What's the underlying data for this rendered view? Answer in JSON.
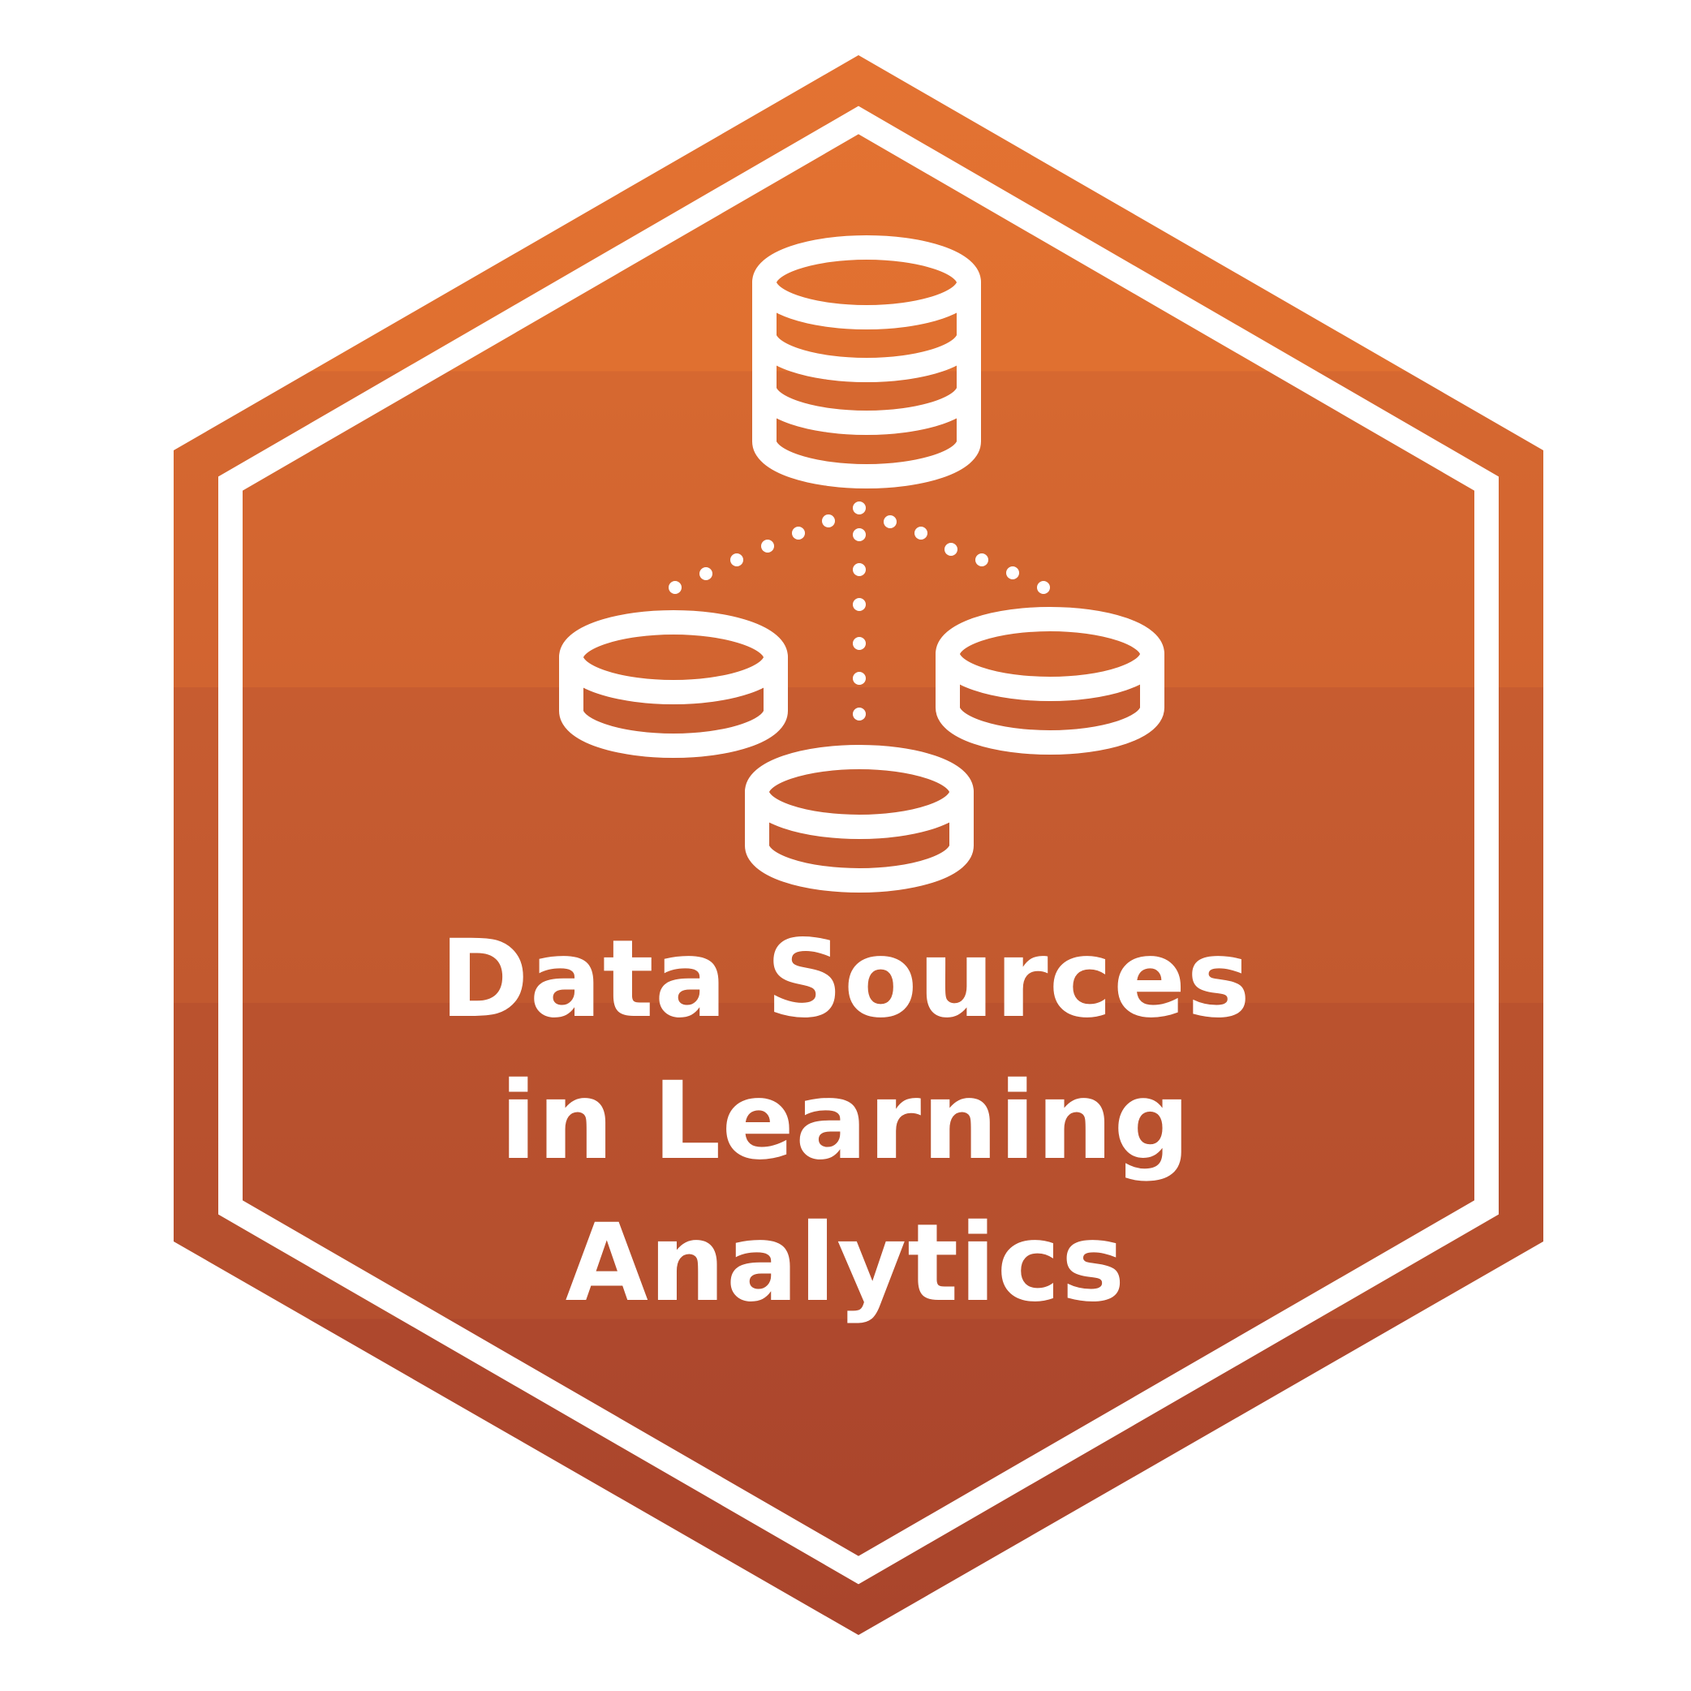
{
  "badge": {
    "title_lines": [
      "Data Sources",
      "in Learning",
      "Analytics"
    ],
    "icon": "database-network-icon",
    "colors": {
      "gradient_top": "#E07030",
      "gradient_bottom": "#AC472D",
      "stroke": "#FFFFFF",
      "background": "#FFFFFF"
    }
  }
}
